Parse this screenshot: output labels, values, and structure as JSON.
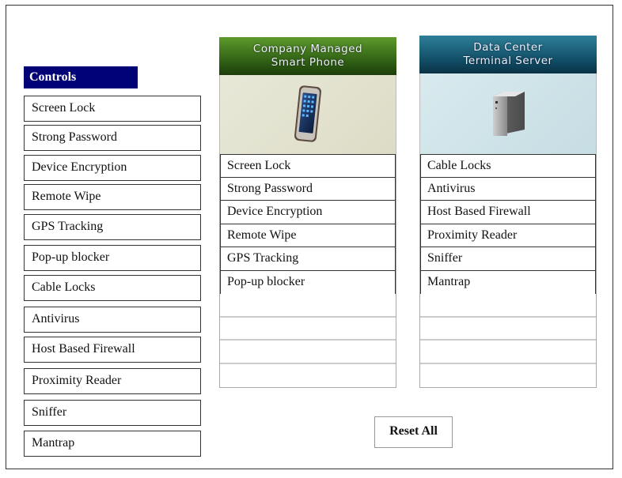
{
  "controls": {
    "header": "Controls",
    "items": [
      {
        "label": "Screen Lock"
      },
      {
        "label": "Strong Password"
      },
      {
        "label": "Device Encryption"
      },
      {
        "label": "Remote Wipe"
      },
      {
        "label": "GPS Tracking"
      },
      {
        "label": "Pop-up blocker"
      },
      {
        "label": "Cable Locks"
      },
      {
        "label": "Antivirus"
      },
      {
        "label": "Host Based Firewall"
      },
      {
        "label": "Proximity Reader"
      },
      {
        "label": "Sniffer"
      },
      {
        "label": "Mantrap"
      }
    ]
  },
  "targets": [
    {
      "title_line1": "Company Managed",
      "title_line2": "Smart Phone",
      "icon": "smartphone-icon",
      "header_color": "#3e6f1c",
      "image_bg": "#e4e4d2",
      "placed": [
        "Screen Lock",
        "Strong Password",
        "Device Encryption",
        "Remote Wipe",
        "GPS Tracking",
        "Pop-up blocker"
      ],
      "empty_slots": 4
    },
    {
      "title_line1": "Data Center",
      "title_line2": "Terminal Server",
      "icon": "server-icon",
      "header_color": "#114a63",
      "image_bg": "#d4e6ea",
      "placed": [
        "Cable Locks",
        "Antivirus",
        "Host Based Firewall",
        "Proximity Reader",
        "Sniffer",
        "Mantrap"
      ],
      "empty_slots": 4
    }
  ],
  "reset_button": "Reset All"
}
